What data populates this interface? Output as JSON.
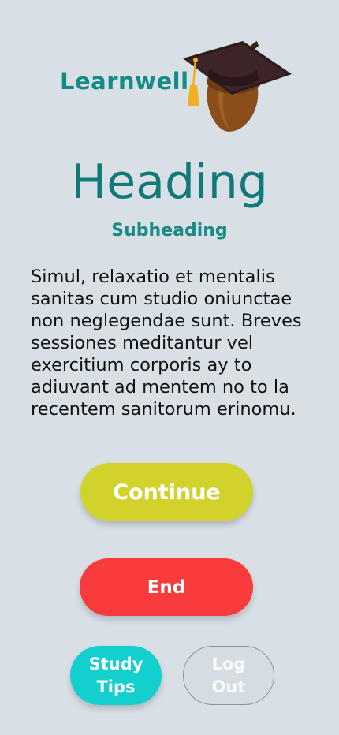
{
  "brand": {
    "name": "Learnwell"
  },
  "content": {
    "heading": "Heading",
    "subheading": "Subheading",
    "body": "Simul, relaxatio et mentalis sanitas cum studio oniunctae non neglegendae sunt. Breves sessiones meditantur vel exercitium corporis ay to adiuvant ad mentem no to la recentem sanitorum erinomu."
  },
  "actions": {
    "continue_label": "Continue",
    "end_label": "End",
    "study_tips_label": "Study\nTips",
    "logout_label": "Log\nOut"
  },
  "colors": {
    "background": "#d8e0e6",
    "brand_teal": "#138c86",
    "continue": "#d2d22c",
    "end": "#fa3b3b",
    "study_tips": "#13d0cf",
    "logout": "#d6dde2"
  },
  "icons": {
    "logo_mark": "acorn-graduation-cap-icon"
  }
}
